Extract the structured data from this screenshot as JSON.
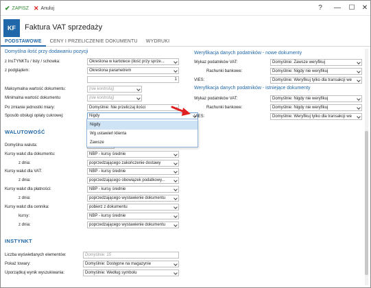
{
  "toolbar": {
    "save_label": "ZAPISZ",
    "cancel_label": "Anuluj"
  },
  "window_controls": {
    "help": "?",
    "minimize": "—",
    "maximize": "☐",
    "close": "✕"
  },
  "header": {
    "badge": "KF",
    "title": "Faktura VAT sprzedaży"
  },
  "tabs": [
    {
      "label": "PODSTAWOWE",
      "active": true
    },
    {
      "label": "CENY I PRZELICZENIE DOKUMENTU",
      "active": false
    },
    {
      "label": "WYDRUKI",
      "active": false
    }
  ],
  "left": {
    "section_link": "Domyślna ilość przy dodawaniu pozycji",
    "fields": [
      {
        "label": "z InsTYNKTu / listy / schowka:",
        "value": "Określona w kartotece (ilość przy sprze..."
      },
      {
        "label": "z podglądem:",
        "value": "Określona parametrem"
      },
      {
        "label": "",
        "value": "1"
      },
      {
        "label": "Maksymalna wartość dokumentu:",
        "value": "(nie kontroluj)"
      },
      {
        "label": "Minimalna wartość dokumentu",
        "value": "(nie kontroluj)"
      },
      {
        "label": "Po zmianie jednostki miary:",
        "value": "Domyślnie: Nie przeliczaj ilości"
      },
      {
        "label": "Sposób obsługi opłaty cukrowej:",
        "value": "Nigdy"
      }
    ],
    "dropdown_options": [
      "Nigdy",
      "Wg ustawień klienta",
      "Zawsze"
    ],
    "waluty_head": "WALUTOWOŚĆ",
    "waluty": [
      {
        "label": "Domyślna waluta:",
        "value": ""
      },
      {
        "label": "Kursy walut dla dokumentu:",
        "value": "NBP - kursy średnie"
      },
      {
        "label": "z dnia:",
        "value": "poprzedzającego zakończenie dostawy"
      },
      {
        "label": "Kursy walut dla VAT:",
        "value": "NBP - kursy średnie"
      },
      {
        "label": "z dnia:",
        "value": "poprzedzającego obowiązek podatkowy..."
      },
      {
        "label": "Kursy walut dla płatności:",
        "value": "NBP - kursy średnie"
      },
      {
        "label": "z dnia:",
        "value": "poprzedzającego wystawienie dokumentu"
      },
      {
        "label": "Kursy walut dla cennika:",
        "value": "pobierz z dokumentu"
      },
      {
        "label": "kursy:",
        "value": "NBP - kursy średnie"
      },
      {
        "label": "z dnia:",
        "value": "poprzedzającego wystawienie dokumentu"
      }
    ],
    "instynkt_head": "INSTYNKT",
    "instynkt": [
      {
        "label": "Liczba wyświetlanych elementów:",
        "value": "Domyślnie: 15"
      },
      {
        "label": "Pokaż towary:",
        "value": "Domyślnie: Dostępne na magazynie"
      },
      {
        "label": "Uporządkuj wynik wyszukiwania:",
        "value": "Domyślnie: Według symbolu"
      }
    ]
  },
  "right": {
    "new_head": "Weryfikacja danych podatników - nowe dokumenty",
    "new_fields": [
      {
        "label": "Wykaz podatników VAT:",
        "value": "Domyślnie: Zawsze weryfikuj"
      },
      {
        "label": "Rachunki bankowe:",
        "value": "Domyślnie: Nigdy nie weryfikuj"
      },
      {
        "label": "VIES:",
        "value": "Domyślnie: Weryfikuj tylko dla transakcji we"
      }
    ],
    "existing_head": "Weryfikacja danych podatników - istniejące dokumenty",
    "existing_fields": [
      {
        "label": "Wykaz podatników VAT:",
        "value": "Domyślnie: Nigdy nie weryfikuj"
      },
      {
        "label": "Rachunki bankowe:",
        "value": "Domyślnie: Nigdy nie weryfikuj"
      },
      {
        "label": "VIES:",
        "value": "Domyślnie: Weryfikuj tylko dla transakcji we"
      }
    ]
  },
  "colors": {
    "accent": "#1f67a8",
    "save": "#2e8b2e",
    "cancel": "#dd2222",
    "arrow": "#e02020",
    "dropdown_selected": "#cfe3f6"
  }
}
